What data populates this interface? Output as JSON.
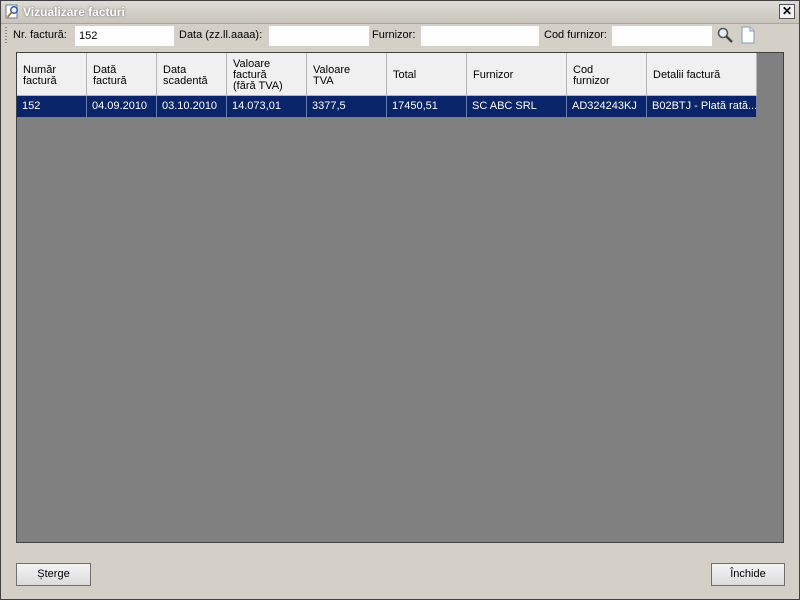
{
  "window": {
    "title": "Vizualizare facturi",
    "close_label": "✕"
  },
  "toolbar": {
    "invoice_no_label": "Nr. factură:",
    "invoice_no_value": "152",
    "date_label": "Data (zz.ll.aaaa):",
    "date_value": "",
    "supplier_label": "Furnizor:",
    "supplier_value": "",
    "supplier_code_label": "Cod furnizor:",
    "supplier_code_value": ""
  },
  "table": {
    "headers": [
      "Număr\nfactură",
      "Dată\nfactură",
      "Data\nscadentă",
      "Valoare\nfactură\n(fără TVA)",
      "Valoare\nTVA",
      "Total",
      "Furnizor",
      "Cod\nfurnizor",
      "Detalii factură"
    ],
    "rows": [
      [
        "152",
        "04.09.2010",
        "03.10.2010",
        "14.073,01",
        "3377,5",
        "17450,51",
        "SC ABC SRL",
        "AD324243KJ",
        "B02BTJ - Plată rată..."
      ]
    ]
  },
  "buttons": {
    "delete_label": "Șterge",
    "close_label": "Închide"
  },
  "colors": {
    "selected_row": "#0a246a",
    "grid_background": "#808080",
    "window_background": "#d4d0c8"
  }
}
